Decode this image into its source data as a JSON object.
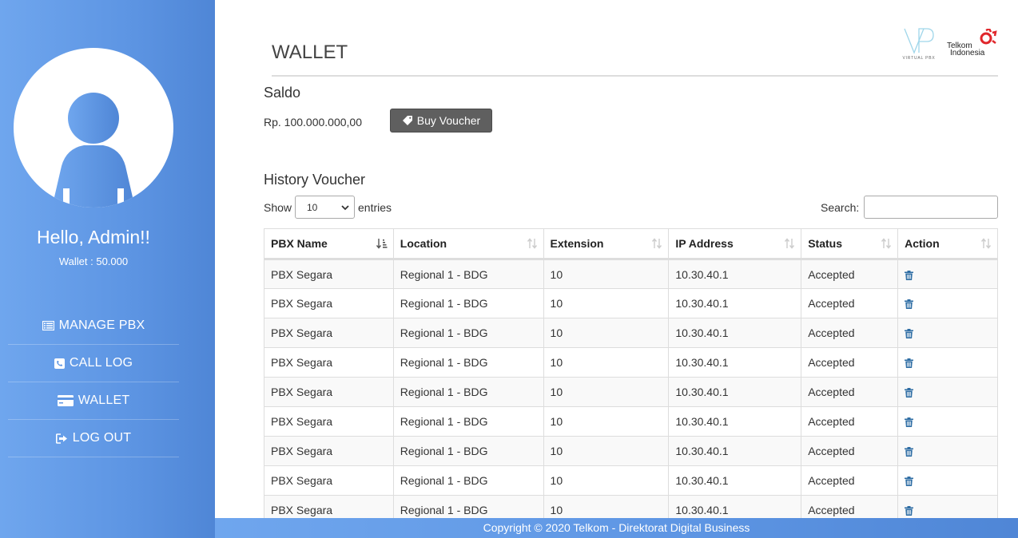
{
  "sidebar": {
    "greeting": "Hello, Admin!!",
    "wallet_label": "Wallet : 50.000",
    "nav": [
      {
        "label": "MANAGE PBX",
        "icon": "list-icon"
      },
      {
        "label": "CALL LOG",
        "icon": "phone-icon"
      },
      {
        "label": "WALLET",
        "icon": "credit-card-icon"
      },
      {
        "label": "LOG OUT",
        "icon": "sign-out-icon"
      }
    ]
  },
  "header": {
    "title": "WALLET",
    "logo_vp_caption": "VIRTUAL PBX",
    "logo_telkom_line1": "Telkom",
    "logo_telkom_line2": "Indonesia"
  },
  "saldo": {
    "title": "Saldo",
    "amount": "Rp. 100.000.000,00",
    "buy_label": "Buy Voucher"
  },
  "history": {
    "title": "History Voucher",
    "show_label": "Show",
    "entries_value": "10",
    "entries_label": "entries",
    "search_label": "Search:",
    "search_value": ""
  },
  "table": {
    "columns": [
      "PBX Name",
      "Location",
      "Extension",
      "IP Address",
      "Status",
      "Action"
    ],
    "rows": [
      {
        "pbx": "PBX Segara",
        "location": "Regional 1 - BDG",
        "extension": "10",
        "ip": "10.30.40.1",
        "status": "Accepted"
      },
      {
        "pbx": "PBX Segara",
        "location": "Regional 1 - BDG",
        "extension": "10",
        "ip": "10.30.40.1",
        "status": "Accepted"
      },
      {
        "pbx": "PBX Segara",
        "location": "Regional 1 - BDG",
        "extension": "10",
        "ip": "10.30.40.1",
        "status": "Accepted"
      },
      {
        "pbx": "PBX Segara",
        "location": "Regional 1 - BDG",
        "extension": "10",
        "ip": "10.30.40.1",
        "status": "Accepted"
      },
      {
        "pbx": "PBX Segara",
        "location": "Regional 1 - BDG",
        "extension": "10",
        "ip": "10.30.40.1",
        "status": "Accepted"
      },
      {
        "pbx": "PBX Segara",
        "location": "Regional 1 - BDG",
        "extension": "10",
        "ip": "10.30.40.1",
        "status": "Accepted"
      },
      {
        "pbx": "PBX Segara",
        "location": "Regional 1 - BDG",
        "extension": "10",
        "ip": "10.30.40.1",
        "status": "Accepted"
      },
      {
        "pbx": "PBX Segara",
        "location": "Regional 1 - BDG",
        "extension": "10",
        "ip": "10.30.40.1",
        "status": "Accepted"
      },
      {
        "pbx": "PBX Segara",
        "location": "Regional 1 - BDG",
        "extension": "10",
        "ip": "10.30.40.1",
        "status": "Accepted"
      }
    ]
  },
  "footer": {
    "text": "Copyright © 2020 Telkom - Direktorat Digital Business"
  },
  "colors": {
    "sidebar_gradient_start": "#6fa6ee",
    "sidebar_gradient_end": "#4f86d6",
    "button_gray": "#5f5f5f",
    "trash_blue": "#2e6da4",
    "telkom_red": "#e0262b"
  }
}
